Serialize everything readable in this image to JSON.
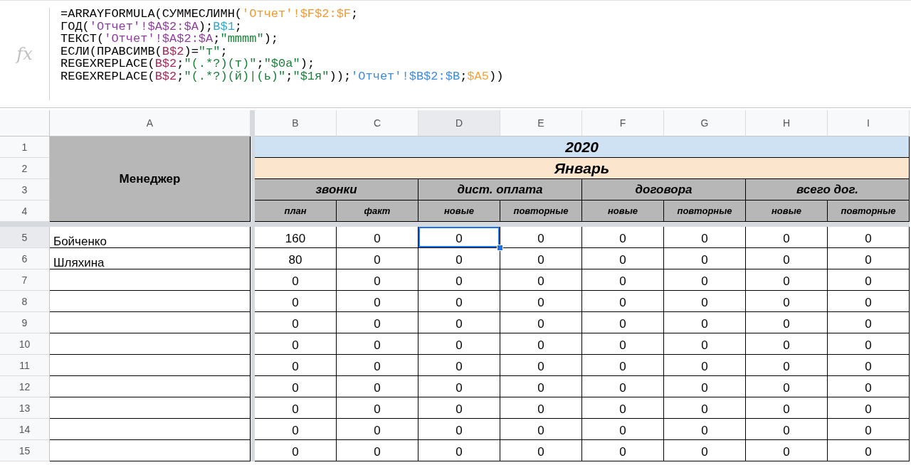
{
  "formula_bar": {
    "icon_label": "fx",
    "lines": [
      [
        {
          "text": "=ARRAYFORMULA(СУММЕСЛИМН(",
          "color": "#000000"
        },
        {
          "text": "'Отчет'!$F$2:$F",
          "color": "#f09a37"
        },
        {
          "text": ";",
          "color": "#000000"
        }
      ],
      [
        {
          "text": "ГОД(",
          "color": "#000000"
        },
        {
          "text": "'Отчет'!$A$2:$A",
          "color": "#8e3e9d"
        },
        {
          "text": ");",
          "color": "#000000"
        },
        {
          "text": "B$1",
          "color": "#2ba7d0"
        },
        {
          "text": ";",
          "color": "#000000"
        }
      ],
      [
        {
          "text": "ТЕКСТ(",
          "color": "#000000"
        },
        {
          "text": "'Отчет'!$A$2:$A",
          "color": "#8e3e9d"
        },
        {
          "text": ";",
          "color": "#000000"
        },
        {
          "text": "\"mmmm\"",
          "color": "#188038"
        },
        {
          "text": ");",
          "color": "#000000"
        }
      ],
      [
        {
          "text": "ЕСЛИ(ПРАВСИМВ(",
          "color": "#000000"
        },
        {
          "text": "B$2",
          "color": "#a6295b"
        },
        {
          "text": ")=",
          "color": "#000000"
        },
        {
          "text": "\"т\"",
          "color": "#188038"
        },
        {
          "text": ";",
          "color": "#000000"
        }
      ],
      [
        {
          "text": "REGEXREPLACE(",
          "color": "#000000"
        },
        {
          "text": "B$2",
          "color": "#a6295b"
        },
        {
          "text": ";",
          "color": "#000000"
        },
        {
          "text": "\"(.*?)(т)\"",
          "color": "#188038"
        },
        {
          "text": ";",
          "color": "#000000"
        },
        {
          "text": "\"$0а\"",
          "color": "#188038"
        },
        {
          "text": ");",
          "color": "#000000"
        }
      ],
      [
        {
          "text": "REGEXREPLACE(",
          "color": "#000000"
        },
        {
          "text": "B$2",
          "color": "#a6295b"
        },
        {
          "text": ";",
          "color": "#000000"
        },
        {
          "text": "\"(.*?)(й)|(ь)\"",
          "color": "#188038"
        },
        {
          "text": ";",
          "color": "#000000"
        },
        {
          "text": "\"$1я\"",
          "color": "#188038"
        },
        {
          "text": "));",
          "color": "#000000"
        },
        {
          "text": "'Отчет'!$B$2:$B",
          "color": "#3d8be0"
        },
        {
          "text": ";",
          "color": "#000000"
        },
        {
          "text": "$A5",
          "color": "#f2a33a"
        },
        {
          "text": "))",
          "color": "#000000"
        }
      ]
    ]
  },
  "columns": [
    {
      "label": "A",
      "selected": false
    },
    {
      "label": "B",
      "selected": false
    },
    {
      "label": "C",
      "selected": false
    },
    {
      "label": "D",
      "selected": true
    },
    {
      "label": "E",
      "selected": false
    },
    {
      "label": "F",
      "selected": false
    },
    {
      "label": "G",
      "selected": false
    },
    {
      "label": "H",
      "selected": false
    },
    {
      "label": "I",
      "selected": false
    }
  ],
  "header": {
    "row_numbers": [
      "1",
      "2",
      "3",
      "4"
    ],
    "manager": "Менеджер",
    "year": "2020",
    "month": "Январь",
    "groups": [
      {
        "label": "звонки",
        "subs": [
          "план",
          "факт"
        ]
      },
      {
        "label": "дист. оплата",
        "subs": [
          "новые",
          "повторные"
        ]
      },
      {
        "label": "договора",
        "subs": [
          "новые",
          "повторные"
        ]
      },
      {
        "label": "всего дог.",
        "subs": [
          "новые",
          "повторные"
        ]
      }
    ]
  },
  "rows": [
    {
      "number": "5",
      "selected": true,
      "manager": "Бойченко",
      "values": [
        {
          "value": "160",
          "selected": false
        },
        {
          "value": "0",
          "selected": false
        },
        {
          "value": "0",
          "selected": true
        },
        {
          "value": "0",
          "selected": false
        },
        {
          "value": "0",
          "selected": false
        },
        {
          "value": "0",
          "selected": false
        },
        {
          "value": "0",
          "selected": false
        },
        {
          "value": "0",
          "selected": false
        }
      ]
    },
    {
      "number": "6",
      "selected": false,
      "manager": "Шляхина",
      "values": [
        {
          "value": "80",
          "selected": false
        },
        {
          "value": "0",
          "selected": false
        },
        {
          "value": "0",
          "selected": false
        },
        {
          "value": "0",
          "selected": false
        },
        {
          "value": "0",
          "selected": false
        },
        {
          "value": "0",
          "selected": false
        },
        {
          "value": "0",
          "selected": false
        },
        {
          "value": "0",
          "selected": false
        }
      ]
    },
    {
      "number": "7",
      "selected": false,
      "values": [
        {
          "value": "0",
          "selected": false
        },
        {
          "value": "0",
          "selected": false
        },
        {
          "value": "0",
          "selected": false
        },
        {
          "value": "0",
          "selected": false
        },
        {
          "value": "0",
          "selected": false
        },
        {
          "value": "0",
          "selected": false
        },
        {
          "value": "0",
          "selected": false
        },
        {
          "value": "0",
          "selected": false
        }
      ]
    },
    {
      "number": "8",
      "selected": false,
      "values": [
        {
          "value": "0",
          "selected": false
        },
        {
          "value": "0",
          "selected": false
        },
        {
          "value": "0",
          "selected": false
        },
        {
          "value": "0",
          "selected": false
        },
        {
          "value": "0",
          "selected": false
        },
        {
          "value": "0",
          "selected": false
        },
        {
          "value": "0",
          "selected": false
        },
        {
          "value": "0",
          "selected": false
        }
      ]
    },
    {
      "number": "9",
      "selected": false,
      "values": [
        {
          "value": "0",
          "selected": false
        },
        {
          "value": "0",
          "selected": false
        },
        {
          "value": "0",
          "selected": false
        },
        {
          "value": "0",
          "selected": false
        },
        {
          "value": "0",
          "selected": false
        },
        {
          "value": "0",
          "selected": false
        },
        {
          "value": "0",
          "selected": false
        },
        {
          "value": "0",
          "selected": false
        }
      ]
    },
    {
      "number": "10",
      "selected": false,
      "values": [
        {
          "value": "0",
          "selected": false
        },
        {
          "value": "0",
          "selected": false
        },
        {
          "value": "0",
          "selected": false
        },
        {
          "value": "0",
          "selected": false
        },
        {
          "value": "0",
          "selected": false
        },
        {
          "value": "0",
          "selected": false
        },
        {
          "value": "0",
          "selected": false
        },
        {
          "value": "0",
          "selected": false
        }
      ]
    },
    {
      "number": "11",
      "selected": false,
      "values": [
        {
          "value": "0",
          "selected": false
        },
        {
          "value": "0",
          "selected": false
        },
        {
          "value": "0",
          "selected": false
        },
        {
          "value": "0",
          "selected": false
        },
        {
          "value": "0",
          "selected": false
        },
        {
          "value": "0",
          "selected": false
        },
        {
          "value": "0",
          "selected": false
        },
        {
          "value": "0",
          "selected": false
        }
      ]
    },
    {
      "number": "12",
      "selected": false,
      "values": [
        {
          "value": "0",
          "selected": false
        },
        {
          "value": "0",
          "selected": false
        },
        {
          "value": "0",
          "selected": false
        },
        {
          "value": "0",
          "selected": false
        },
        {
          "value": "0",
          "selected": false
        },
        {
          "value": "0",
          "selected": false
        },
        {
          "value": "0",
          "selected": false
        },
        {
          "value": "0",
          "selected": false
        }
      ]
    },
    {
      "number": "13",
      "selected": false,
      "values": [
        {
          "value": "0",
          "selected": false
        },
        {
          "value": "0",
          "selected": false
        },
        {
          "value": "0",
          "selected": false
        },
        {
          "value": "0",
          "selected": false
        },
        {
          "value": "0",
          "selected": false
        },
        {
          "value": "0",
          "selected": false
        },
        {
          "value": "0",
          "selected": false
        },
        {
          "value": "0",
          "selected": false
        }
      ]
    },
    {
      "number": "14",
      "selected": false,
      "values": [
        {
          "value": "0",
          "selected": false
        },
        {
          "value": "0",
          "selected": false
        },
        {
          "value": "0",
          "selected": false
        },
        {
          "value": "0",
          "selected": false
        },
        {
          "value": "0",
          "selected": false
        },
        {
          "value": "0",
          "selected": false
        },
        {
          "value": "0",
          "selected": false
        },
        {
          "value": "0",
          "selected": false
        }
      ]
    },
    {
      "number": "15",
      "selected": false,
      "values": [
        {
          "value": "0",
          "selected": false
        },
        {
          "value": "0",
          "selected": false
        },
        {
          "value": "0",
          "selected": false
        },
        {
          "value": "0",
          "selected": false
        },
        {
          "value": "0",
          "selected": false
        },
        {
          "value": "0",
          "selected": false
        },
        {
          "value": "0",
          "selected": false
        },
        {
          "value": "0",
          "selected": false
        }
      ]
    }
  ]
}
